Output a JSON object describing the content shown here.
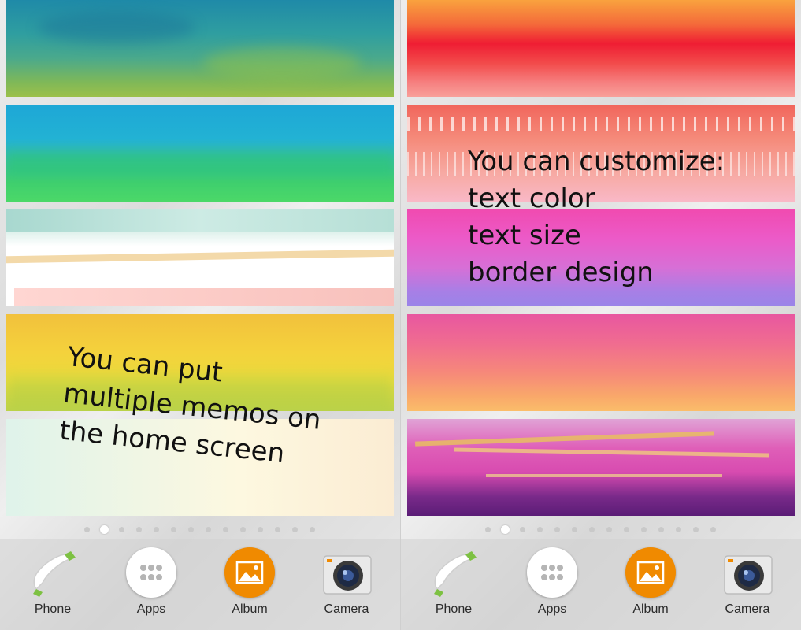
{
  "screens": [
    {
      "caption": "You can put\nmultiple memos on\nthe home screen"
    },
    {
      "caption": "You can customize:\ntext color\ntext size\nborder design"
    }
  ],
  "page_indicator": {
    "page_count": 14,
    "current_page": 2
  },
  "dock": {
    "phone": {
      "label": "Phone",
      "icon": "phone-handset-icon"
    },
    "apps": {
      "label": "Apps",
      "icon": "app-grid-icon"
    },
    "album": {
      "label": "Album",
      "icon": "album-icon"
    },
    "camera": {
      "label": "Camera",
      "icon": "camera-icon"
    }
  },
  "colors": {
    "album_orange": "#f08a00",
    "phone_green": "#7dc142",
    "camera_lens": "#1e2a44"
  }
}
